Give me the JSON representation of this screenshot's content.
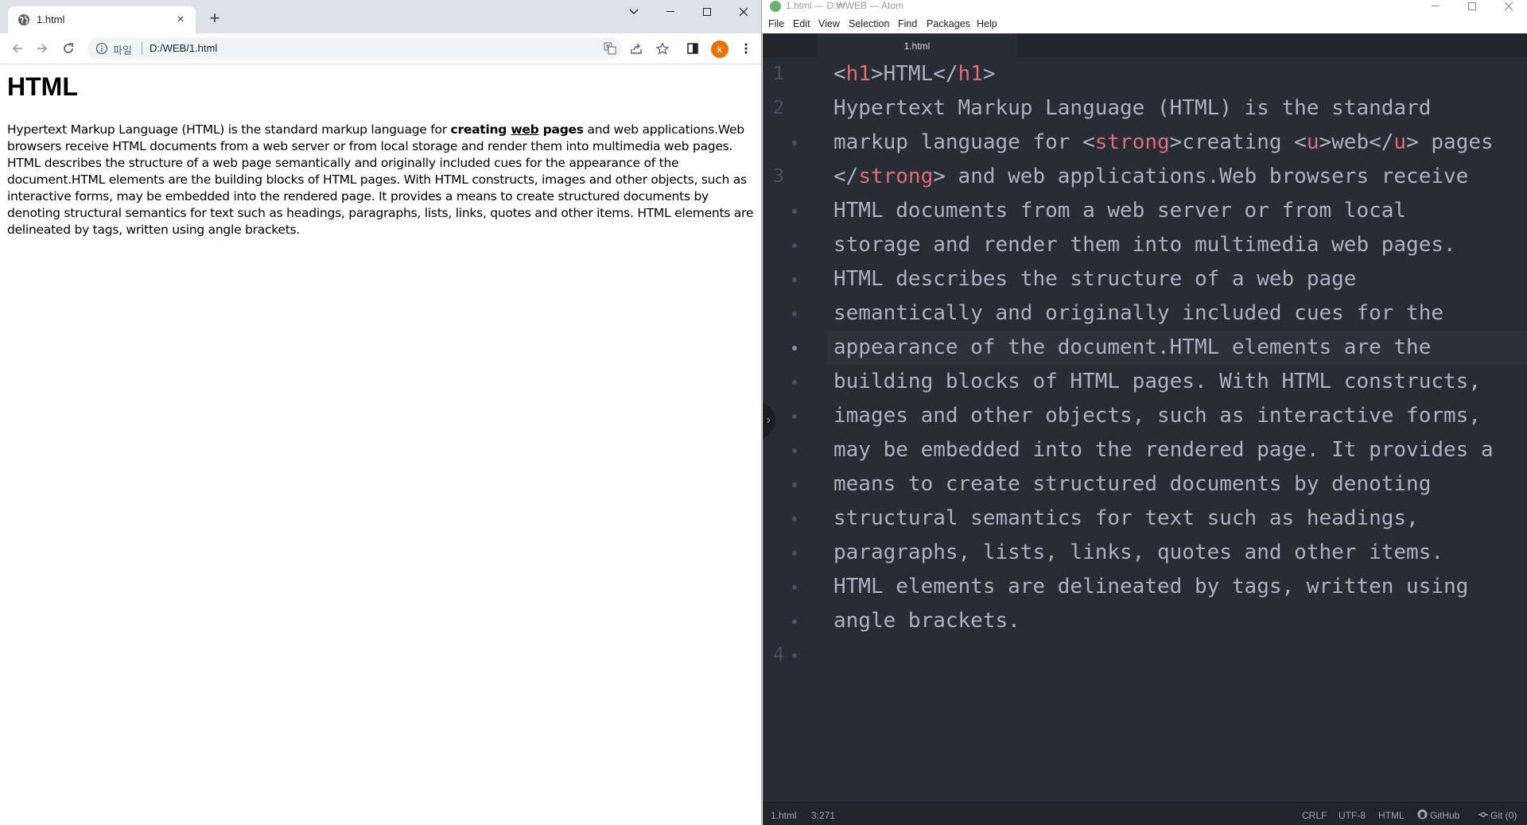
{
  "browser": {
    "tab_title": "1.html",
    "tab_close": "×",
    "new_tab": "+",
    "address_scheme": "파일",
    "address_url": "D:/WEB/1.html",
    "profile_initial": "k"
  },
  "page": {
    "heading": "HTML",
    "text_before": "Hypertext Markup Language (HTML) is the standard markup language for ",
    "strong_1": "creating ",
    "strong_underlined": "web",
    "strong_2": " pages",
    "text_after": " and web applications.Web browsers receive HTML documents from a web server or from local storage and render them into multimedia web pages. HTML describes the structure of a web page semantically and originally included cues for the appearance of the document.HTML elements are the building blocks of HTML pages. With HTML constructs, images and other objects, such as interactive forms, may be embedded into the rendered page. It provides a means to create structured documents by denoting structural semantics for text such as headings, paragraphs, lists, links, quotes and other items. HTML elements are delineated by tags, written using angle brackets."
  },
  "atom": {
    "window_title": "1.html — D:₩WEB — Atom",
    "menu": [
      "File",
      "Edit",
      "View",
      "Selection",
      "Find",
      "Packages",
      "Help"
    ],
    "tab_title": "1.html",
    "line_numbers": [
      "1",
      "2",
      "3",
      "4"
    ],
    "code": {
      "l1_a": "<",
      "l1_tag": "h1",
      "l1_b": ">HTML</",
      "l1_tag2": "h1",
      "l1_c": ">",
      "l2": "Hypertext Markup Language (HTML) is the standard",
      "l3_a": "markup language for <",
      "l3_tag": "strong",
      "l3_b": ">creating <",
      "l3_tag2": "u",
      "l3_c": ">web</",
      "l3_tag3": "u",
      "l3_d": "> pages",
      "l4_a": "</",
      "l4_tag": "strong",
      "l4_b": "> and web applications.Web browsers receive",
      "l5": "HTML documents from a web server or from local",
      "l6": "storage and render them into multimedia web pages.",
      "l7": "HTML describes the structure of a web page",
      "l8": "semantically and originally included cues for the",
      "l9": "appearance of the document.HTML elements are the",
      "l10": "building blocks of HTML pages. With HTML constructs,",
      "l11": "images and other objects, such as interactive forms,",
      "l12": "may be embedded into the rendered page. It provides a",
      "l13": "means to create structured documents by denoting",
      "l14": "structural semantics for text such as headings,",
      "l15": "paragraphs, lists, links, quotes and other items.",
      "l16": "HTML elements are delineated by tags, written using",
      "l17": "angle brackets."
    },
    "status": {
      "file": "1.html",
      "cursor": "3:271",
      "line_ending": "CRLF",
      "encoding": "UTF-8",
      "grammar": "HTML",
      "github": "GitHub",
      "git": "Git (0)"
    }
  }
}
